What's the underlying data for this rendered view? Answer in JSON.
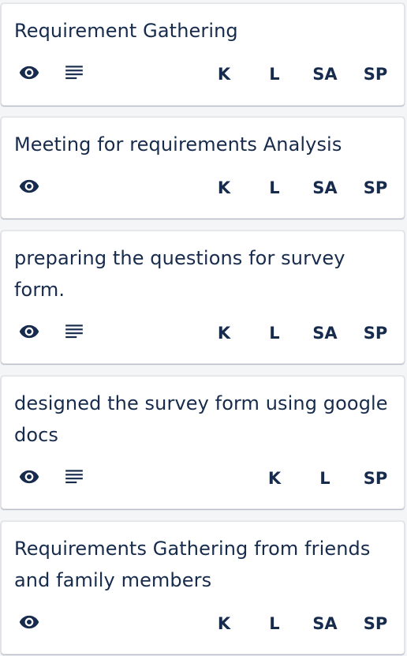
{
  "cards": [
    {
      "title": "Requirement Gathering",
      "icons": [
        "eye-icon",
        "description-icon"
      ],
      "members": [
        "K",
        "L",
        "SA",
        "SP"
      ]
    },
    {
      "title": "Meeting for requirements Analysis",
      "icons": [
        "eye-icon"
      ],
      "members": [
        "K",
        "L",
        "SA",
        "SP"
      ]
    },
    {
      "title": "preparing the questions for survey form.",
      "icons": [
        "eye-icon",
        "description-icon"
      ],
      "members": [
        "K",
        "L",
        "SA",
        "SP"
      ]
    },
    {
      "title": "designed the survey form using google docs",
      "icons": [
        "eye-icon",
        "description-icon"
      ],
      "members": [
        "K",
        "L",
        "SP"
      ]
    },
    {
      "title": "Requirements Gathering from friends and family members",
      "icons": [
        "eye-icon"
      ],
      "members": [
        "K",
        "L",
        "SA",
        "SP"
      ]
    }
  ]
}
